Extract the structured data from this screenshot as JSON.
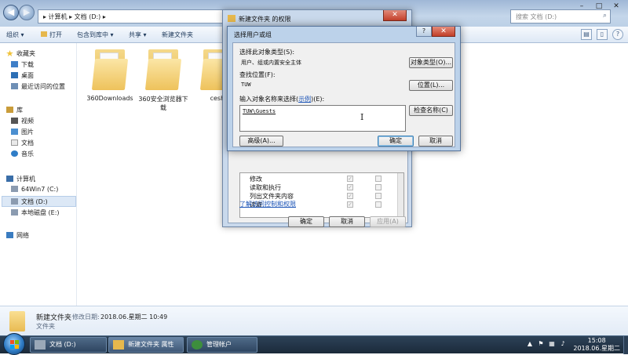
{
  "explorer": {
    "address_path": "▸ 计算机 ▸ 文档 (D:) ▸",
    "search_placeholder": "搜索 文档 (D:)",
    "toolbar": {
      "organize": "组织 ▾",
      "open": "打开",
      "include_in_library": "包含到库中 ▾",
      "share": "共享 ▾",
      "new_folder": "新建文件夹"
    },
    "sidebar": {
      "favorites": "收藏夹",
      "downloads": "下载",
      "desktop": "桌面",
      "recent": "最近访问的位置",
      "libraries": "库",
      "videos": "视频",
      "pictures": "图片",
      "documents": "文档",
      "music": "音乐",
      "computer": "计算机",
      "drive_c": "64Win7 (C:)",
      "drive_d": "文档 (D:)",
      "drive_e": "本地磁盘 (E:)",
      "network": "网络"
    },
    "folders": [
      {
        "name": "360Downloads"
      },
      {
        "name": "360安全浏览器下载"
      },
      {
        "name": "ceshi"
      }
    ],
    "details": {
      "name": "新建文件夹",
      "modified_label": "修改日期:",
      "modified_value": "2018.06.星期二 10:49",
      "type": "文件夹"
    }
  },
  "props_dialog": {
    "title": "新建文件夹 的权限",
    "close": "✕",
    "perm_rows": [
      "修改",
      "读取和执行",
      "列出文件夹内容",
      "读取"
    ],
    "advanced_link": "了解访问控制和权限",
    "ok": "确定",
    "cancel": "取消",
    "apply": "应用(A)"
  },
  "select_dialog": {
    "title": "选择用户或组",
    "help": "?",
    "close": "✕",
    "object_type_label": "选择此对象类型(S):",
    "object_type_value": "用户、组或内置安全主体",
    "object_type_button": "对象类型(O)...",
    "location_label": "查找位置(F):",
    "location_value": "TUW",
    "location_button": "位置(L)...",
    "names_label_pre": "输入对象名称来选择(",
    "names_label_link": "示例",
    "names_label_post": ")(E):",
    "names_value": "TUW\\Guests",
    "check_names_button": "检查名称(C)",
    "advanced_button": "高级(A)...",
    "ok": "确定",
    "cancel": "取消"
  },
  "taskbar": {
    "task1": "文档 (D:)",
    "task2": "新建文件夹 属性",
    "task3": "管理帐户",
    "time": "15:08",
    "date": "2018.06.星期二"
  }
}
